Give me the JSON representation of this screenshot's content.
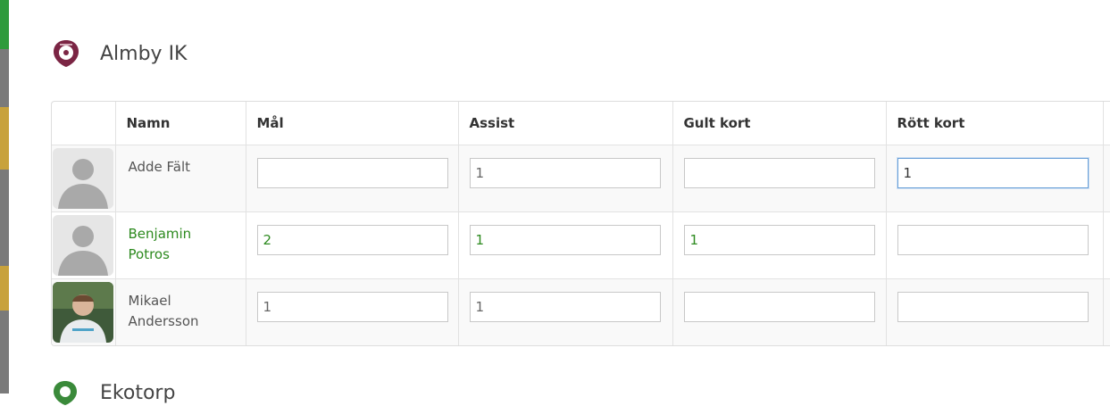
{
  "team": {
    "name": "Almby IK",
    "logo_icon": "team-crest-icon",
    "logo_color": "#7b2544"
  },
  "table": {
    "headers": [
      "Namn",
      "Mål",
      "Assist",
      "Gult kort",
      "Rött kort"
    ],
    "rows": [
      {
        "name": "Adde Fält",
        "avatar": "default-avatar-icon",
        "goals": "",
        "assists": "1",
        "yellow": "",
        "red": "1",
        "highlight": false
      },
      {
        "name": "Benjamin Potros",
        "avatar": "default-avatar-icon",
        "goals": "2",
        "assists": "1",
        "yellow": "1",
        "red": "",
        "highlight": true
      },
      {
        "name": "Mikael Andersson",
        "avatar": "photo-avatar",
        "goals": "1",
        "assists": "1",
        "yellow": "",
        "red": "",
        "highlight": false
      }
    ]
  },
  "next_team": {
    "name": "Ekotorp",
    "logo_icon": "team-crest-icon"
  },
  "colors": {
    "highlight": "#2d8a1f",
    "focus_border": "#6aa0d8"
  }
}
